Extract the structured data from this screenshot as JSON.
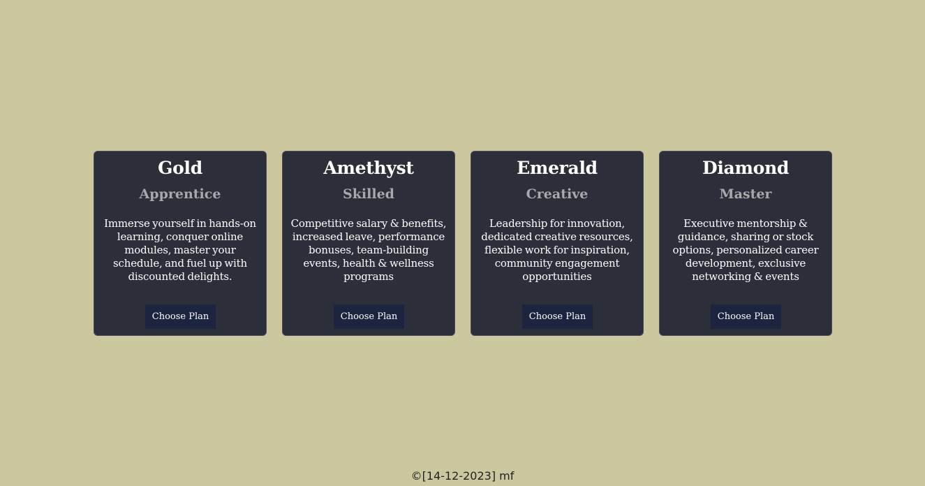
{
  "plans": [
    {
      "name": "Gold",
      "tier": "Apprentice",
      "description": "Immerse yourself in hands-on learning, conquer online modules, master your schedule, and fuel up with discounted delights.",
      "button_label": "Choose Plan"
    },
    {
      "name": "Amethyst",
      "tier": "Skilled",
      "description": "Competitive salary & benefits, increased leave, performance bonuses, team-building events, health & wellness programs",
      "button_label": "Choose Plan"
    },
    {
      "name": "Emerald",
      "tier": "Creative",
      "description": "Leadership for innovation, dedicated creative resources, flexible work for inspiration, community engagement opportunities",
      "button_label": "Choose Plan"
    },
    {
      "name": "Diamond",
      "tier": "Master",
      "description": "Executive mentorship & guidance, sharing or stock options, personalized career development, exclusive networking & events",
      "button_label": "Choose Plan"
    }
  ],
  "footer": {
    "text": "©[14-12-2023] mf"
  }
}
